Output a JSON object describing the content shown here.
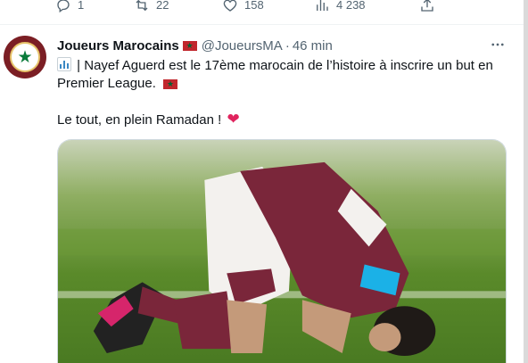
{
  "top_actions": {
    "reply": {
      "icon": "reply-icon",
      "count": "1"
    },
    "retweet": {
      "icon": "retweet-icon",
      "count": "22"
    },
    "like": {
      "icon": "heart-icon",
      "count": "158"
    },
    "views": {
      "icon": "analytics-icon",
      "count": "4 238"
    },
    "share": {
      "icon": "share-icon"
    }
  },
  "tweet": {
    "author_name": "Joueurs Marocains",
    "handle": "@JoueursMA",
    "separator": "·",
    "time": "46 min",
    "text_line1": "| Nayef Aguerd est le 17ème marocain de l’histoire à inscrire un but en Premier League.",
    "text_line2": "Le tout, en plein Ramadan !",
    "media": {
      "image": "football-player-prostrating-on-pitch"
    }
  },
  "colors": {
    "muted": "#536471",
    "maroon": "#7a263a",
    "sky_blue": "#1bb1e7",
    "heart_red": "#e0245e",
    "pitch_green": "#5a8a2a"
  }
}
